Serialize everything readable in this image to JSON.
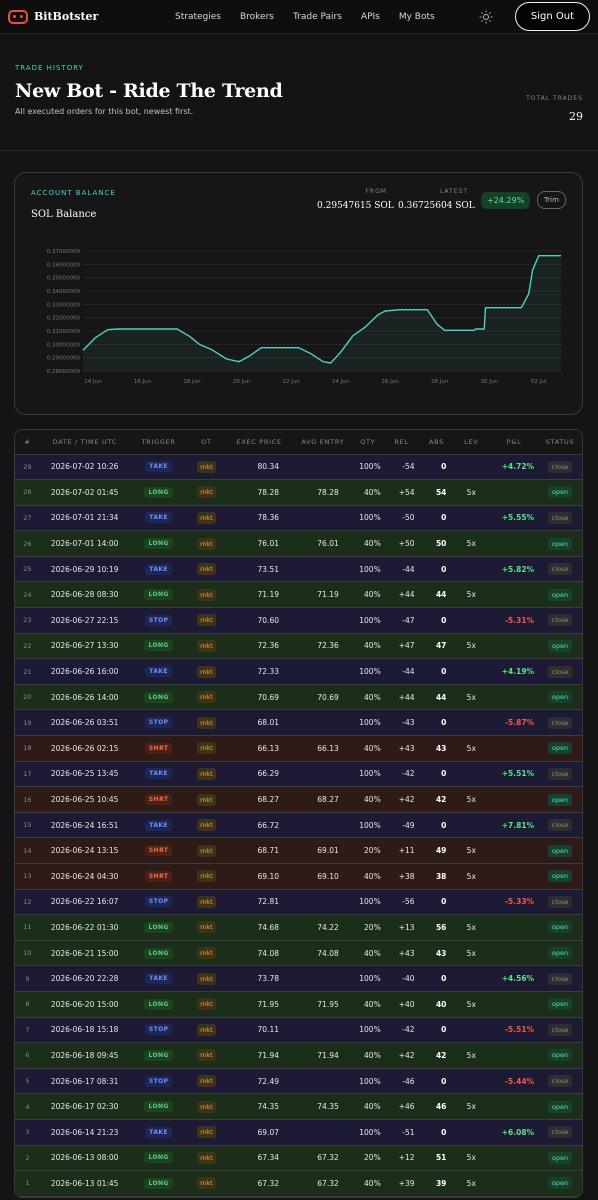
{
  "nav": {
    "brand": "BitBotster",
    "links": [
      "Strategies",
      "Brokers",
      "Trade Pairs",
      "APIs",
      "My Bots"
    ],
    "sign_out": "Sign Out"
  },
  "header": {
    "eyebrow": "TRADE HISTORY",
    "title": "New Bot - Ride The Trend",
    "subtitle": "All executed orders for this bot, newest first.",
    "total_label": "TOTAL TRADES",
    "total_value": "29"
  },
  "balance": {
    "eyebrow": "ACCOUNT BALANCE",
    "title": "SOL Balance",
    "from_label": "FROM",
    "from_value": "0.29547615 SOL",
    "latest_label": "LATEST",
    "latest_value": "0.36725604 SOL",
    "change": "+24.29%",
    "trim_label": "Trim"
  },
  "chart_data": {
    "type": "line",
    "x_ticks": [
      "14 Jun",
      "16 Jun",
      "18 Jun",
      "20 Jun",
      "22 Jun",
      "24 Jun",
      "26 Jun",
      "28 Jun",
      "30 Jun",
      "02 Jul"
    ],
    "y_ticks": [
      "0.37000000",
      "0.36000000",
      "0.35000000",
      "0.34000000",
      "0.33000000",
      "0.32000000",
      "0.31000000",
      "0.30000000",
      "0.29000000",
      "0.28000000"
    ],
    "ylim": [
      0.28,
      0.37
    ],
    "xlim_days": [
      13.6,
      32.9
    ],
    "points": [
      [
        13.6,
        0.2955
      ],
      [
        14.1,
        0.305
      ],
      [
        14.6,
        0.311
      ],
      [
        15.0,
        0.3115
      ],
      [
        17.4,
        0.3115
      ],
      [
        17.9,
        0.306
      ],
      [
        18.3,
        0.3
      ],
      [
        18.8,
        0.296
      ],
      [
        19.4,
        0.289
      ],
      [
        19.9,
        0.287
      ],
      [
        20.3,
        0.291
      ],
      [
        20.8,
        0.2975
      ],
      [
        22.3,
        0.2975
      ],
      [
        22.8,
        0.293
      ],
      [
        23.3,
        0.287
      ],
      [
        23.6,
        0.286
      ],
      [
        24.0,
        0.294
      ],
      [
        24.5,
        0.3065
      ],
      [
        25.0,
        0.313
      ],
      [
        25.5,
        0.322
      ],
      [
        25.8,
        0.325
      ],
      [
        26.4,
        0.326
      ],
      [
        27.5,
        0.326
      ],
      [
        27.9,
        0.315
      ],
      [
        28.2,
        0.3105
      ],
      [
        29.4,
        0.3105
      ],
      [
        29.45,
        0.3115
      ],
      [
        29.8,
        0.3115
      ],
      [
        29.85,
        0.3275
      ],
      [
        31.3,
        0.3275
      ],
      [
        31.6,
        0.338
      ],
      [
        31.75,
        0.3555
      ],
      [
        32.0,
        0.3665
      ],
      [
        32.9,
        0.3665
      ]
    ]
  },
  "table": {
    "headers": [
      "#",
      "DATE / TIME UTC",
      "TRIGGER",
      "OT",
      "EXEC PRICE",
      "AVG ENTRY",
      "QTY",
      "REL",
      "ABS",
      "LEV",
      "P&L",
      "STATUS"
    ],
    "rows": [
      {
        "num": "29",
        "date": "2026-07-02 10:26",
        "trigger": "TAKE",
        "ot": "mkt",
        "exec": "80.34",
        "avg": "",
        "qty": "100%",
        "rel": "-54",
        "abs": "0",
        "lev": "",
        "pnl": "+4.72%",
        "status": "close"
      },
      {
        "num": "28",
        "date": "2026-07-02 01:45",
        "trigger": "LONG",
        "ot": "mkt",
        "exec": "78.28",
        "avg": "78.28",
        "qty": "40%",
        "rel": "+54",
        "abs": "54",
        "lev": "5x",
        "pnl": "",
        "status": "open"
      },
      {
        "num": "27",
        "date": "2026-07-01 21:34",
        "trigger": "TAKE",
        "ot": "mkt",
        "exec": "78.36",
        "avg": "",
        "qty": "100%",
        "rel": "-50",
        "abs": "0",
        "lev": "",
        "pnl": "+5.55%",
        "status": "close"
      },
      {
        "num": "26",
        "date": "2026-07-01 14:00",
        "trigger": "LONG",
        "ot": "mkt",
        "exec": "76.01",
        "avg": "76.01",
        "qty": "40%",
        "rel": "+50",
        "abs": "50",
        "lev": "5x",
        "pnl": "",
        "status": "open"
      },
      {
        "num": "25",
        "date": "2026-06-29 10:19",
        "trigger": "TAKE",
        "ot": "mkt",
        "exec": "73.51",
        "avg": "",
        "qty": "100%",
        "rel": "-44",
        "abs": "0",
        "lev": "",
        "pnl": "+5.82%",
        "status": "close"
      },
      {
        "num": "24",
        "date": "2026-06-28 08:30",
        "trigger": "LONG",
        "ot": "mkt",
        "exec": "71.19",
        "avg": "71.19",
        "qty": "40%",
        "rel": "+44",
        "abs": "44",
        "lev": "5x",
        "pnl": "",
        "status": "open"
      },
      {
        "num": "23",
        "date": "2026-06-27 22:15",
        "trigger": "STOP",
        "ot": "mkt",
        "exec": "70.60",
        "avg": "",
        "qty": "100%",
        "rel": "-47",
        "abs": "0",
        "lev": "",
        "pnl": "-5.31%",
        "status": "close"
      },
      {
        "num": "22",
        "date": "2026-06-27 13:30",
        "trigger": "LONG",
        "ot": "mkt",
        "exec": "72.36",
        "avg": "72.36",
        "qty": "40%",
        "rel": "+47",
        "abs": "47",
        "lev": "5x",
        "pnl": "",
        "status": "open"
      },
      {
        "num": "21",
        "date": "2026-06-26 16:00",
        "trigger": "TAKE",
        "ot": "mkt",
        "exec": "72.33",
        "avg": "",
        "qty": "100%",
        "rel": "-44",
        "abs": "0",
        "lev": "",
        "pnl": "+4.19%",
        "status": "close"
      },
      {
        "num": "20",
        "date": "2026-06-26 14:00",
        "trigger": "LONG",
        "ot": "mkt",
        "exec": "70.69",
        "avg": "70.69",
        "qty": "40%",
        "rel": "+44",
        "abs": "44",
        "lev": "5x",
        "pnl": "",
        "status": "open"
      },
      {
        "num": "19",
        "date": "2026-06-26 03:51",
        "trigger": "STOP",
        "ot": "mkt",
        "exec": "68.01",
        "avg": "",
        "qty": "100%",
        "rel": "-43",
        "abs": "0",
        "lev": "",
        "pnl": "-5.87%",
        "status": "close"
      },
      {
        "num": "18",
        "date": "2026-06-26 02:15",
        "trigger": "SHRT",
        "ot": "mkt",
        "exec": "66.13",
        "avg": "66.13",
        "qty": "40%",
        "rel": "+43",
        "abs": "43",
        "lev": "5x",
        "pnl": "",
        "status": "open"
      },
      {
        "num": "17",
        "date": "2026-06-25 13:45",
        "trigger": "TAKE",
        "ot": "mkt",
        "exec": "66.29",
        "avg": "",
        "qty": "100%",
        "rel": "-42",
        "abs": "0",
        "lev": "",
        "pnl": "+5.51%",
        "status": "close"
      },
      {
        "num": "16",
        "date": "2026-06-25 10:45",
        "trigger": "SHRT",
        "ot": "mkt",
        "exec": "68.27",
        "avg": "68.27",
        "qty": "40%",
        "rel": "+42",
        "abs": "42",
        "lev": "5x",
        "pnl": "",
        "status": "open"
      },
      {
        "num": "15",
        "date": "2026-06-24 16:51",
        "trigger": "TAKE",
        "ot": "mkt",
        "exec": "66.72",
        "avg": "",
        "qty": "100%",
        "rel": "-49",
        "abs": "0",
        "lev": "",
        "pnl": "+7.81%",
        "status": "close"
      },
      {
        "num": "14",
        "date": "2026-06-24 13:15",
        "trigger": "SHRT",
        "ot": "mkt",
        "exec": "68.71",
        "avg": "69.01",
        "qty": "20%",
        "rel": "+11",
        "abs": "49",
        "lev": "5x",
        "pnl": "",
        "status": "open"
      },
      {
        "num": "13",
        "date": "2026-06-24 04:30",
        "trigger": "SHRT",
        "ot": "mkt",
        "exec": "69.10",
        "avg": "69.10",
        "qty": "40%",
        "rel": "+38",
        "abs": "38",
        "lev": "5x",
        "pnl": "",
        "status": "open"
      },
      {
        "num": "12",
        "date": "2026-06-22 16:07",
        "trigger": "STOP",
        "ot": "mkt",
        "exec": "72.81",
        "avg": "",
        "qty": "100%",
        "rel": "-56",
        "abs": "0",
        "lev": "",
        "pnl": "-5.33%",
        "status": "close"
      },
      {
        "num": "11",
        "date": "2026-06-22 01:30",
        "trigger": "LONG",
        "ot": "mkt",
        "exec": "74.68",
        "avg": "74.22",
        "qty": "20%",
        "rel": "+13",
        "abs": "56",
        "lev": "5x",
        "pnl": "",
        "status": "open"
      },
      {
        "num": "10",
        "date": "2026-06-21 15:00",
        "trigger": "LONG",
        "ot": "mkt",
        "exec": "74.08",
        "avg": "74.08",
        "qty": "40%",
        "rel": "+43",
        "abs": "43",
        "lev": "5x",
        "pnl": "",
        "status": "open"
      },
      {
        "num": "9",
        "date": "2026-06-20 22:28",
        "trigger": "TAKE",
        "ot": "mkt",
        "exec": "73.78",
        "avg": "",
        "qty": "100%",
        "rel": "-40",
        "abs": "0",
        "lev": "",
        "pnl": "+4.56%",
        "status": "close"
      },
      {
        "num": "8",
        "date": "2026-06-20 15:00",
        "trigger": "LONG",
        "ot": "mkt",
        "exec": "71.95",
        "avg": "71.95",
        "qty": "40%",
        "rel": "+40",
        "abs": "40",
        "lev": "5x",
        "pnl": "",
        "status": "open"
      },
      {
        "num": "7",
        "date": "2026-06-18 15:18",
        "trigger": "STOP",
        "ot": "mkt",
        "exec": "70.11",
        "avg": "",
        "qty": "100%",
        "rel": "-42",
        "abs": "0",
        "lev": "",
        "pnl": "-5.51%",
        "status": "close"
      },
      {
        "num": "6",
        "date": "2026-06-18 09:45",
        "trigger": "LONG",
        "ot": "mkt",
        "exec": "71.94",
        "avg": "71.94",
        "qty": "40%",
        "rel": "+42",
        "abs": "42",
        "lev": "5x",
        "pnl": "",
        "status": "open"
      },
      {
        "num": "5",
        "date": "2026-06-17 08:31",
        "trigger": "STOP",
        "ot": "mkt",
        "exec": "72.49",
        "avg": "",
        "qty": "100%",
        "rel": "-46",
        "abs": "0",
        "lev": "",
        "pnl": "-5.44%",
        "status": "close"
      },
      {
        "num": "4",
        "date": "2026-06-17 02:30",
        "trigger": "LONG",
        "ot": "mkt",
        "exec": "74.35",
        "avg": "74.35",
        "qty": "40%",
        "rel": "+46",
        "abs": "46",
        "lev": "5x",
        "pnl": "",
        "status": "open"
      },
      {
        "num": "3",
        "date": "2026-06-14 21:23",
        "trigger": "TAKE",
        "ot": "mkt",
        "exec": "69.07",
        "avg": "",
        "qty": "100%",
        "rel": "-51",
        "abs": "0",
        "lev": "",
        "pnl": "+6.08%",
        "status": "close"
      },
      {
        "num": "2",
        "date": "2026-06-13 08:00",
        "trigger": "LONG",
        "ot": "mkt",
        "exec": "67.34",
        "avg": "67.32",
        "qty": "20%",
        "rel": "+12",
        "abs": "51",
        "lev": "5x",
        "pnl": "",
        "status": "open"
      },
      {
        "num": "1",
        "date": "2026-06-13 01:45",
        "trigger": "LONG",
        "ot": "mkt",
        "exec": "67.32",
        "avg": "67.32",
        "qty": "40%",
        "rel": "+39",
        "abs": "39",
        "lev": "5x",
        "pnl": "",
        "status": "open"
      }
    ]
  }
}
